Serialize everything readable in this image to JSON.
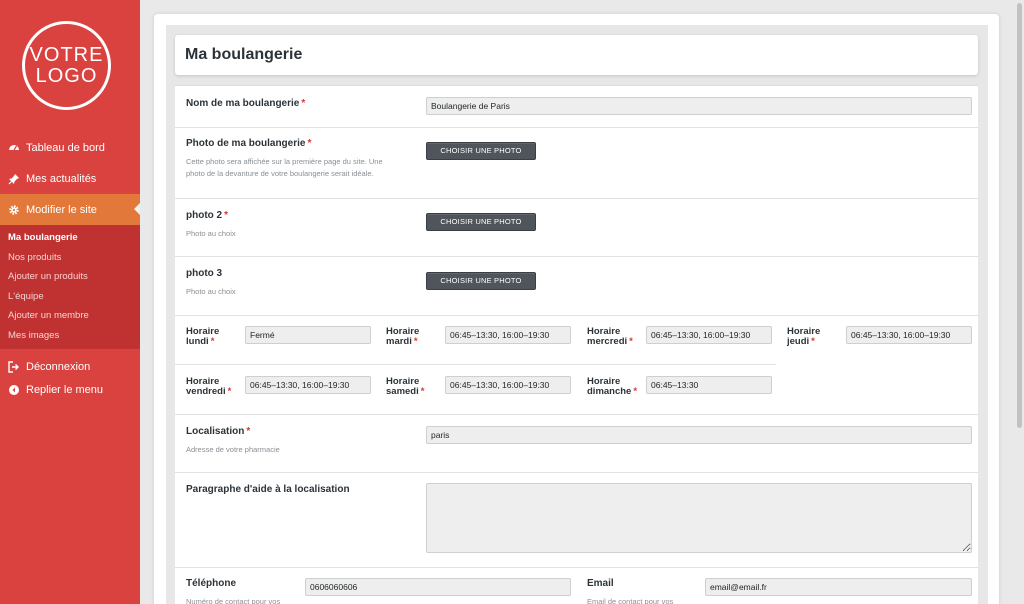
{
  "logo": {
    "line1": "VOTRE",
    "line2": "LOGO"
  },
  "menu": {
    "dashboard": "Tableau de bord",
    "news": "Mes actualités",
    "edit_site": "Modifier le site",
    "submenu": [
      "Ma boulangerie",
      "Nos produits",
      "Ajouter un produits",
      "L'équipe",
      "Ajouter un membre",
      "Mes images"
    ],
    "logout": "Déconnexion",
    "collapse": "Replier le menu"
  },
  "page": {
    "title": "Ma boulangerie"
  },
  "form": {
    "required_mark": "*",
    "name": {
      "label": "Nom de ma boulangerie",
      "value": "Boulangerie de Paris"
    },
    "photo": {
      "label": "Photo de ma boulangerie",
      "desc1": "Cette photo sera affichée sur la première page du site. Une",
      "desc2": "photo de la devanture de votre boulangerie serait idéale.",
      "button": "CHOISIR UNE PHOTO"
    },
    "photo2": {
      "label": "photo 2",
      "desc": "Photo au choix",
      "button": "CHOISIR UNE PHOTO"
    },
    "photo3": {
      "label": "photo 3",
      "desc": "Photo au choix",
      "button": "CHOISIR UNE PHOTO"
    },
    "hours": {
      "word": "Horaire",
      "monday": {
        "day": "lundi",
        "value": "Fermé"
      },
      "tuesday": {
        "day": "mardi",
        "value": "06:45–13:30, 16:00–19:30"
      },
      "wednesday": {
        "day": "mercredi",
        "value": "06:45–13:30, 16:00–19:30"
      },
      "thursday": {
        "day": "jeudi",
        "value": "06:45–13:30, 16:00–19:30"
      },
      "friday": {
        "day": "vendredi",
        "value": "06:45–13:30, 16:00–19:30"
      },
      "saturday": {
        "day": "samedi",
        "value": "06:45–13:30, 16:00–19:30"
      },
      "sunday": {
        "day": "dimanche",
        "value": "06:45–13:30"
      }
    },
    "location": {
      "label": "Localisation",
      "desc": "Adresse de votre pharmacie",
      "value": "paris"
    },
    "location_help": {
      "label": "Paragraphe d'aide à la localisation",
      "value": ""
    },
    "phone": {
      "label": "Téléphone",
      "desc": "Numéro de contact pour vos",
      "value": "0606060606"
    },
    "email": {
      "label": "Email",
      "desc": "Email de contact pour vos",
      "value": "email@email.fr"
    }
  },
  "colors": {
    "sidebar": "#d9423f",
    "active": "#e2793a",
    "submenu": "#c03232",
    "required": "#d63638"
  }
}
